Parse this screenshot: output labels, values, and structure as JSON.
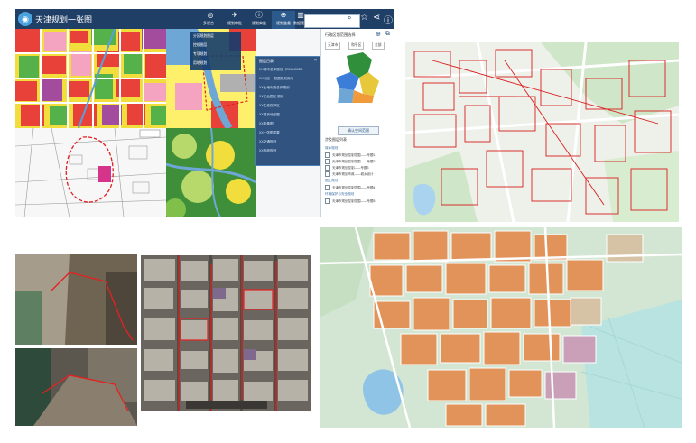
{
  "app": {
    "title": "天津规划一张图",
    "nav": [
      {
        "label": "多规合一",
        "icon": "globe-icon"
      },
      {
        "label": "规划审批",
        "icon": "plane-icon"
      },
      {
        "label": "规划实施",
        "icon": "info-icon"
      },
      {
        "label": "规划监督",
        "icon": "compass-icon"
      },
      {
        "label": "数据管理",
        "icon": "building-icon"
      }
    ],
    "search": {
      "placeholder": ""
    },
    "sub_menu": [
      "分区规划图层",
      "控规图层",
      "专项规划",
      "用地规划"
    ],
    "layer_panel": {
      "title": "图层目录",
      "rows": [
        "XX城市总体规划（2016-2035）",
        "XX分区  一张图规划用地",
        "XX土地利用总体规划",
        "XX工业园区  规划",
        "XX生态保护区",
        "XX现状地形图",
        "XX影像图",
        "XX一张图成果",
        "XX交通规划",
        "XX市政规划"
      ]
    },
    "right_panel": {
      "title": "行政区划范围选择",
      "selects": [
        "天津市",
        "和平区",
        "全部"
      ],
      "button": "确认空间范围",
      "section": "涉及图层列表",
      "groups": [
        {
          "name": "城乡规划",
          "items": [
            "天津市规划控制范围——专题1",
            "天津市规划控制范围——专题2",
            "天津市规划控制——专题3",
            "天津市规划市政——城乡设计"
          ]
        },
        {
          "name": "国土规划",
          "items": [
            "天津市规划控制范围——专题4"
          ]
        },
        {
          "name": "环境保护与安全规划",
          "items": [
            "天津市规划控制范围——专题5"
          ]
        }
      ]
    }
  }
}
